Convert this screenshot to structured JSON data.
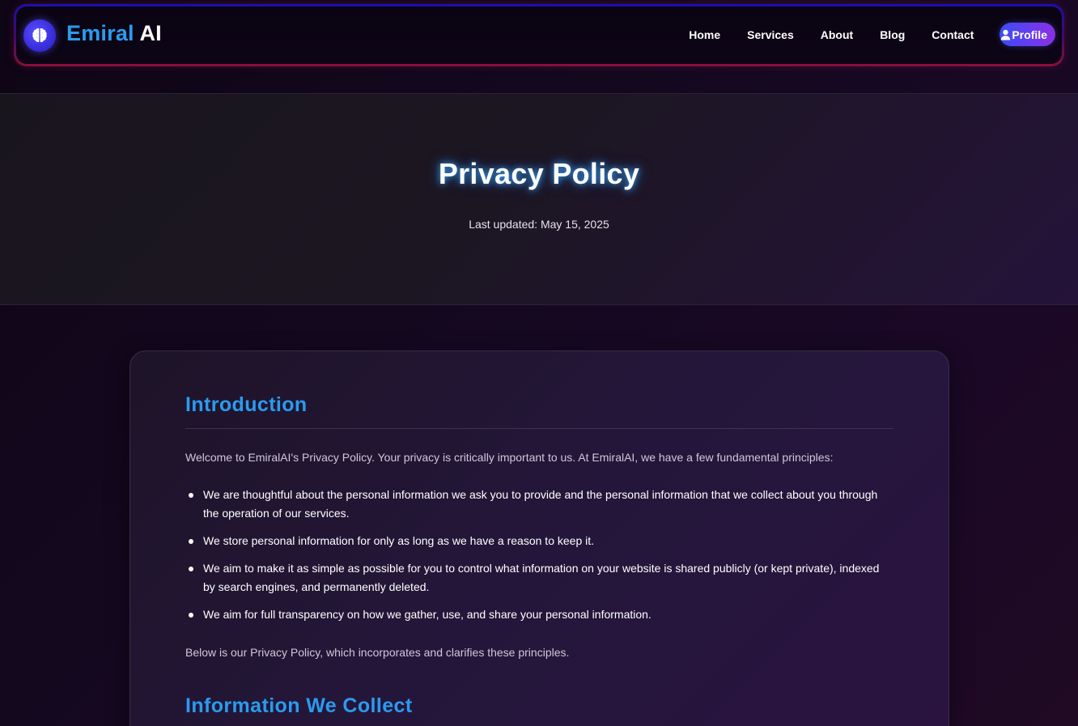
{
  "nav": {
    "brand_part1": "Emiral",
    "brand_part2": "AI",
    "logo_icon": "brain-icon",
    "links": [
      "Home",
      "Services",
      "About",
      "Blog",
      "Contact"
    ],
    "profile_label": "Profile",
    "profile_icon": "user-icon"
  },
  "hero": {
    "title": "Privacy Policy",
    "updated": "Last updated: May 15, 2025"
  },
  "content": {
    "intro_title": "Introduction",
    "intro_text": "Welcome to EmiralAI's Privacy Policy. Your privacy is critically important to us. At EmiralAI, we have a few fundamental principles:",
    "bullets": [
      "We are thoughtful about the personal information we ask you to provide and the personal information that we collect about you through the operation of our services.",
      "We store personal information for only as long as we have a reason to keep it.",
      "We aim to make it as simple as possible for you to control what information on your website is shared publicly (or kept private), indexed by search engines, and permanently deleted.",
      "We aim for full transparency on how we gather, use, and share your personal information."
    ],
    "closing_text": "Below is our Privacy Policy, which incorporates and clarifies these principles.",
    "next_title": "Information We Collect"
  },
  "colors": {
    "accent_blue": "#2a9bf0",
    "profile_gradient_start": "#3a4cf5",
    "profile_gradient_end": "#8b2fe0",
    "nav_border_top": "#1a0fb0",
    "nav_border_bottom": "#8a0f3a"
  }
}
